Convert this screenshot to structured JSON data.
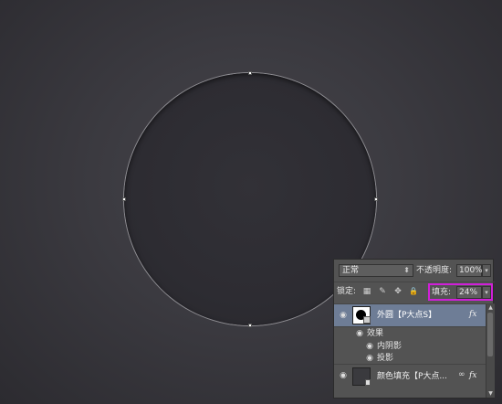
{
  "layers_panel": {
    "blend_mode": "正常",
    "blend_arrow": "⬍",
    "opacity_label": "不透明度:",
    "opacity_value": "100%",
    "lock_label": "锁定:",
    "fill_label": "填充:",
    "fill_value": "24%",
    "dropdown_arrow": "▾",
    "layers": [
      {
        "name": "外圆【P大点S】",
        "selected": true,
        "fx": "fx",
        "effects_label": "效果",
        "effects": [
          "内阴影",
          "投影"
        ]
      },
      {
        "name": "颜色填充【P大点...",
        "selected": false,
        "fx": "fx"
      }
    ]
  },
  "icons": {
    "eye": "◉",
    "lock_pixels": "▦",
    "lock_brush": "✎",
    "lock_move": "✥",
    "lock_all": "🔒",
    "scroll_up": "▲",
    "scroll_down": "▼",
    "link": "∞"
  },
  "colors": {
    "highlight_box": "#d01fd8",
    "selected_layer": "#6e7d96"
  }
}
